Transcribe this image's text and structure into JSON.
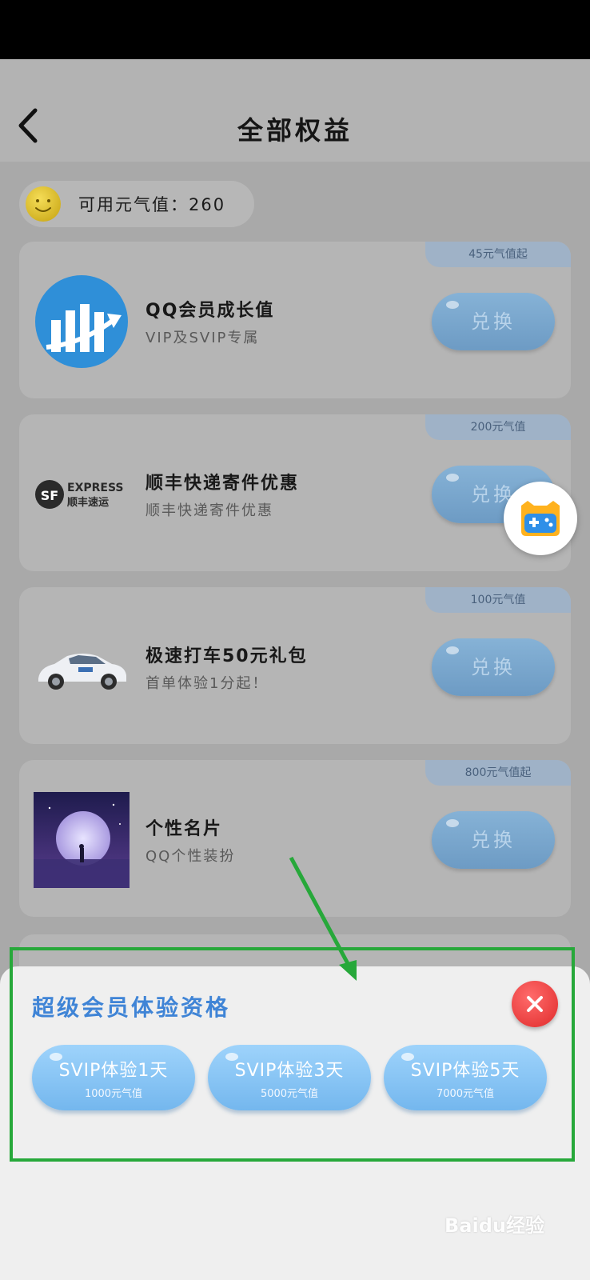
{
  "header": {
    "title": "全部权益"
  },
  "energy": {
    "label": "可用元气值：260"
  },
  "cards": [
    {
      "tag": "45元气值起",
      "title": "QQ会员成长值",
      "subtitle": "VIP及SVIP专属",
      "button": "兑换",
      "image": "growth-chart-logo"
    },
    {
      "tag": "200元气值",
      "title": "顺丰快递寄件优惠",
      "subtitle": "顺丰快递寄件优惠",
      "button": "兑换",
      "image": "sf-express-logo"
    },
    {
      "tag": "100元气值",
      "title": "极速打车50元礼包",
      "subtitle": "首单体验1分起！",
      "button": "兑换",
      "image": "car-image"
    },
    {
      "tag": "800元气值起",
      "title": "个性名片",
      "subtitle": "QQ个性装扮",
      "button": "兑换",
      "image": "moon-night-image"
    }
  ],
  "sf_logo": {
    "sf": "SF",
    "express": "EXPRESS",
    "cn": "顺丰速运"
  },
  "sheet": {
    "title": "超级会员体验资格",
    "options": [
      {
        "title": "SVIP体验1天",
        "cost": "1000元气值"
      },
      {
        "title": "SVIP体验3天",
        "cost": "5000元气值"
      },
      {
        "title": "SVIP体验5天",
        "cost": "7000元气值"
      }
    ]
  },
  "watermark": {
    "text": "Baidu经验"
  },
  "colors": {
    "accent": "#3f84d6",
    "button": "#74b7ee",
    "close": "#e02b2b",
    "highlight": "#27a83a"
  }
}
